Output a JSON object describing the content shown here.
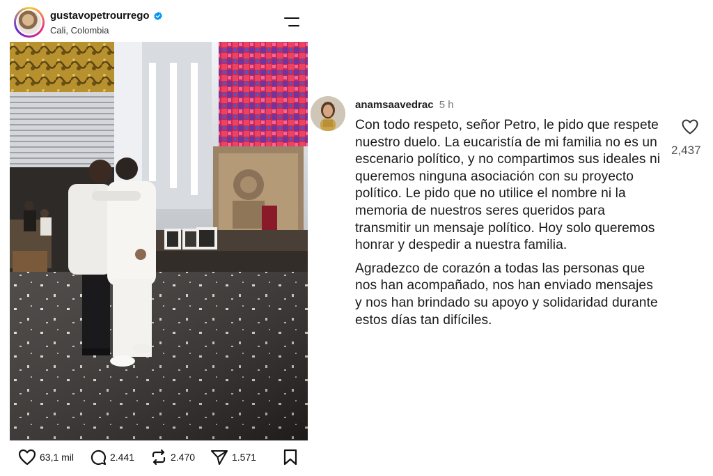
{
  "post": {
    "username": "gustavopetrourrego",
    "location": "Cali, Colombia",
    "verified": true,
    "actions": {
      "likes": "63,1 mil",
      "comments": "2.441",
      "reposts": "2.470",
      "shares": "1.571"
    }
  },
  "comment": {
    "username": "anamsaavedrac",
    "time": "5 h",
    "paragraphs": [
      "Con todo respeto, señor Petro, le pido que respete nuestro duelo. La eucaristía de mi familia no es un escenario político, y no compartimos sus ideales ni queremos ninguna asociación con su proyecto político. Le pido que no utilice el nombre ni la memoria de nuestros seres queridos para transmitir un mensaje político. Hoy solo queremos honrar y despedir a nuestra familia.",
      "Agradezco de corazón a todas las personas que nos han acompañado, nos han enviado mensajes y nos han brindado su apoyo y solidaridad durante estos días tan difíciles."
    ],
    "like_count": "2,437"
  },
  "colors": {
    "verified_blue": "#0095f6",
    "text_primary": "#111111",
    "text_secondary": "#777777"
  },
  "icons": [
    "avatar",
    "verified-badge-icon",
    "menu-icon",
    "heart-icon",
    "comment-icon",
    "repost-icon",
    "share-icon",
    "bookmark-icon"
  ]
}
